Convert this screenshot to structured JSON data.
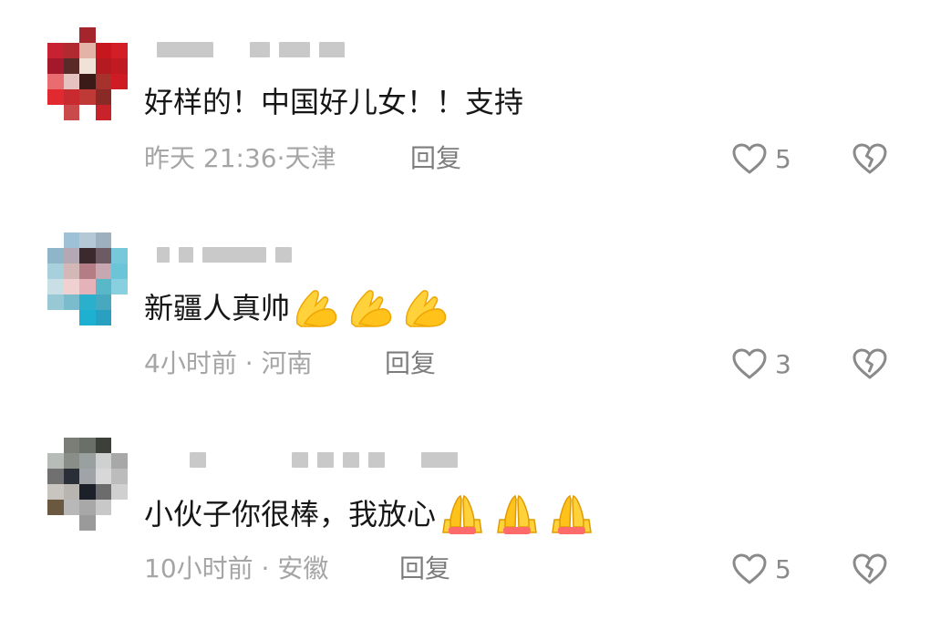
{
  "comments": [
    {
      "text": "好样的！中国好儿女！！支持",
      "time": "昨天 21:36",
      "location": "天津",
      "reply_label": "回复",
      "likes": "5",
      "emoji": ""
    },
    {
      "text": "新疆人真帅",
      "time": "4小时前",
      "location": "河南",
      "reply_label": "回复",
      "likes": "3",
      "emoji": "praying-hands-icon"
    },
    {
      "text": "小伙子你很棒，我放心",
      "time": "10小时前",
      "location": "安徽",
      "reply_label": "回复",
      "likes": "5",
      "emoji": "praying-hands-icon"
    }
  ],
  "colors": {
    "text": "#161616",
    "meta": "#a5a5a5",
    "reply": "#7d7d7d",
    "icon": "#8a8a8a",
    "emoji_light": "#ffd23c",
    "emoji_dark": "#ffc21a",
    "emoji_cuff": "#ff6b6b"
  },
  "icons": [
    "heart-outline-icon",
    "broken-heart-icon",
    "praying-hands-icon"
  ]
}
